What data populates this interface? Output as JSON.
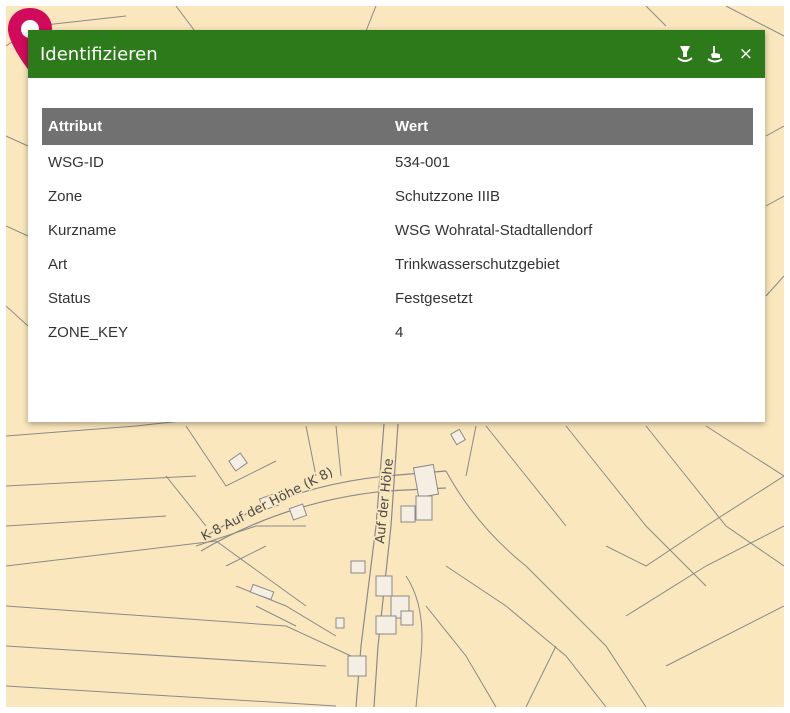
{
  "panel": {
    "title": "Identifizieren",
    "icons": [
      "pin-down-icon",
      "pin-pointer-icon",
      "close-icon"
    ],
    "close_label": "×",
    "header_color": "#2c7a1a"
  },
  "table": {
    "headers": [
      "Attribut",
      "Wert"
    ],
    "rows": [
      [
        "WSG-ID",
        "534-001"
      ],
      [
        "Zone",
        "Schutzzone IIIB"
      ],
      [
        "Kurzname",
        "WSG Wohratal-Stadtallendorf"
      ],
      [
        "Art",
        "Trinkwasserschutzgebiet"
      ],
      [
        "Status",
        "Festgesetzt"
      ],
      [
        "ZONE_KEY",
        "4"
      ]
    ]
  },
  "map": {
    "street_labels": [
      "K 8 Auf der Höhe (K 8)",
      "Auf der Höhe"
    ],
    "background_color": "#fbe7bd",
    "marker_color": "#d10a5c"
  }
}
